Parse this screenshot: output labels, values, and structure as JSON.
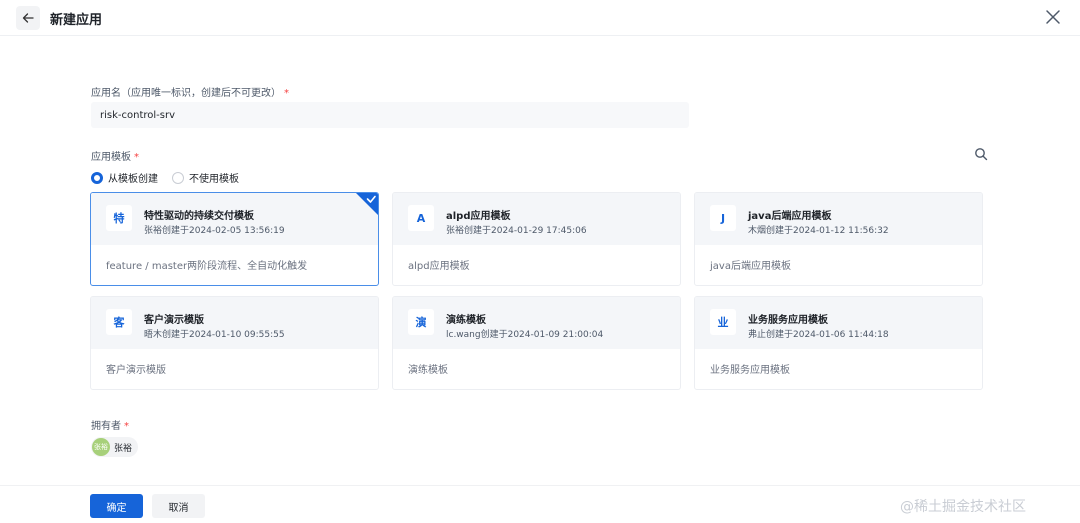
{
  "header": {
    "title": "新建应用"
  },
  "app_name": {
    "label": "应用名（应用唯一标识，创建后不可更改）",
    "value": "risk-control-srv"
  },
  "template": {
    "label": "应用模板",
    "options": [
      "从模板创建",
      "不使用模板"
    ],
    "selected_option": "从模板创建",
    "cards": [
      {
        "icon_char": "特",
        "title": "特性驱动的持续交付模板",
        "meta": "张裕创建于2024-02-05 13:56:19",
        "desc": "feature / master两阶段流程、全自动化触发",
        "selected": true
      },
      {
        "icon_char": "A",
        "title": "alpd应用模板",
        "meta": "张裕创建于2024-01-29 17:45:06",
        "desc": "alpd应用模板",
        "selected": false
      },
      {
        "icon_char": "J",
        "title": "java后端应用模板",
        "meta": "木烟创建于2024-01-12 11:56:32",
        "desc": "java后端应用模板",
        "selected": false
      },
      {
        "icon_char": "客",
        "title": "客户演示模版",
        "meta": "晤木创建于2024-01-10 09:55:55",
        "desc": "客户演示模版",
        "selected": false
      },
      {
        "icon_char": "演",
        "title": "演练模板",
        "meta": "lc.wang创建于2024-01-09 21:00:04",
        "desc": "演练模板",
        "selected": false
      },
      {
        "icon_char": "业",
        "title": "业务服务应用模板",
        "meta": "弗止创建于2024-01-06 11:44:18",
        "desc": "业务服务应用模板",
        "selected": false
      }
    ]
  },
  "owner": {
    "label": "拥有者",
    "avatar_text": "张裕",
    "name": "张裕"
  },
  "footer": {
    "confirm_label": "确定",
    "cancel_label": "取消"
  },
  "watermark": "@稀土掘金技术社区",
  "colors": {
    "primary": "#1664d9",
    "required": "#f53f3f",
    "avatar": "#a7d07a"
  }
}
